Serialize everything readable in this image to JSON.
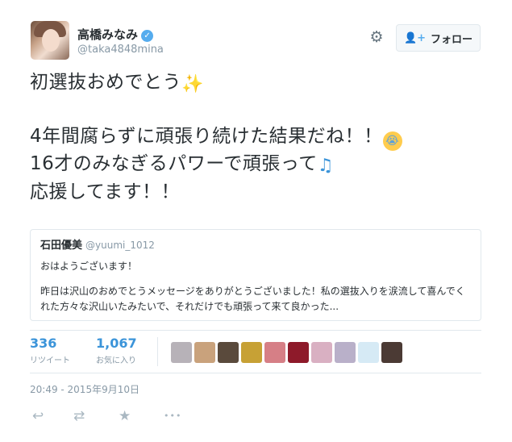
{
  "header": {
    "display_name": "高橋みなみ",
    "verified_symbol": "✓",
    "handle": "@taka4848mina",
    "gear_symbol": "⚙",
    "follow_icon_symbol": "👤+",
    "follow_label": "フォロー"
  },
  "tweet": {
    "line1": "初選抜おめでとう",
    "line2": "4年間腐らずに頑張り続けた結果だね！！",
    "line3": "16才のみなぎるパワーで頑張って",
    "line4": "応援してます！！",
    "emoji_sparkles": "✨",
    "emoji_cry": "😭",
    "emoji_note": "♫"
  },
  "quote": {
    "author": "石田優美",
    "handle": "@yuumi_1012",
    "line1": "おはようございます！",
    "body": "昨日は沢山のおめでとうメッセージをありがとうございました！私の選抜入りを涙流して喜んでくれた方々な沢山いたみたいで、それだけでも頑張って来て良かった..."
  },
  "stats": {
    "retweets": {
      "value": "336",
      "label": "リツイート"
    },
    "likes": {
      "value": "1,067",
      "label": "お気に入り"
    }
  },
  "likers": [
    {
      "name": "liker-avatar-1",
      "color": "#b7b2b8"
    },
    {
      "name": "liker-avatar-2",
      "color": "#c9a27c"
    },
    {
      "name": "liker-avatar-3",
      "color": "#5a4a3c"
    },
    {
      "name": "liker-avatar-4",
      "color": "#c7a135"
    },
    {
      "name": "liker-avatar-5",
      "color": "#d67f86"
    },
    {
      "name": "liker-avatar-6",
      "color": "#8e1a2a"
    },
    {
      "name": "liker-avatar-7",
      "color": "#d9b0c2"
    },
    {
      "name": "liker-avatar-8",
      "color": "#b9b0c9"
    },
    {
      "name": "liker-avatar-9",
      "color": "#d6eaf5"
    },
    {
      "name": "liker-avatar-10",
      "color": "#4b3a34"
    }
  ],
  "timestamp": "20:49 - 2015年9月10日",
  "actions": {
    "reply_symbol": "↩",
    "retweet_symbol": "⇄",
    "favorite_symbol": "★",
    "more_symbol": "•••"
  },
  "colors": {
    "accent": "#55acee",
    "link": "#3b94d9",
    "muted": "#8899a6",
    "border": "#e1e8ed"
  }
}
